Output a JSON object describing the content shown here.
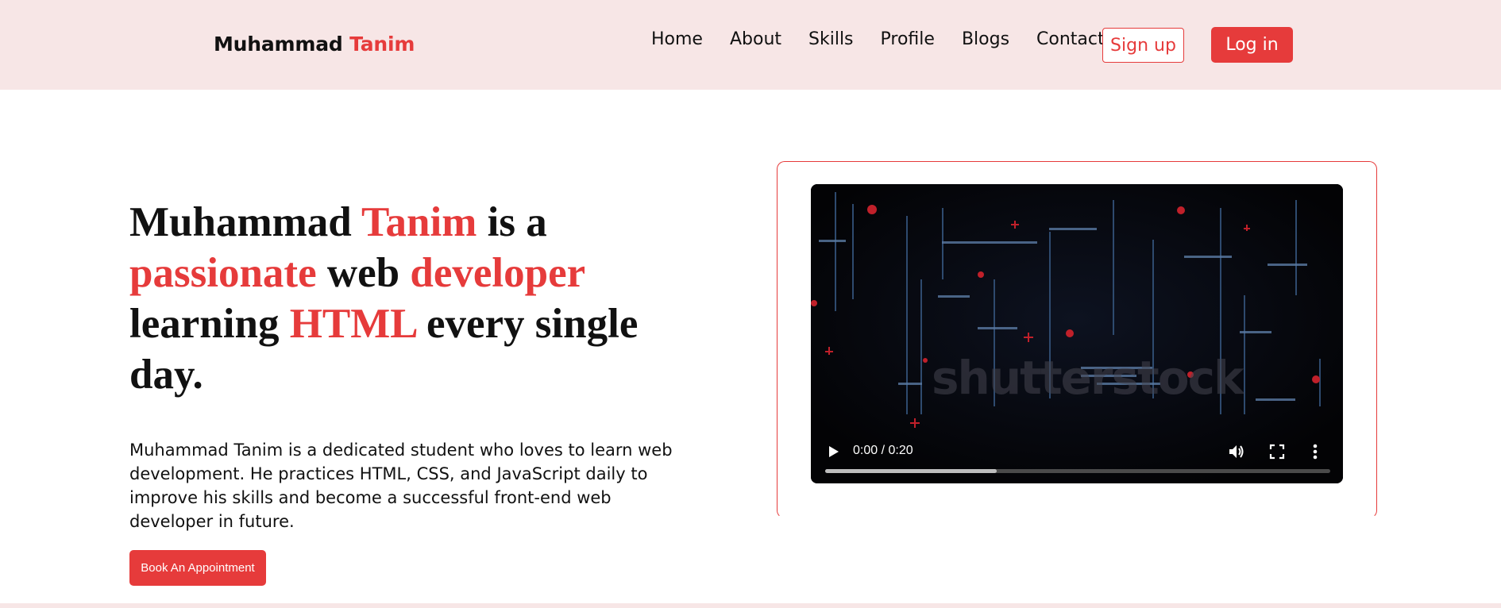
{
  "header": {
    "brand_first": "Muhammad",
    "brand_accent": "Tanim",
    "nav": [
      "Home",
      "About",
      "Skills",
      "Profile",
      "Blogs",
      "Contact"
    ],
    "signup_label": "Sign up",
    "login_label": "Log in"
  },
  "hero": {
    "title_parts": {
      "p1": "Muhammad ",
      "p2": "Tanim",
      "p3": " is a ",
      "p4": "passionate",
      "p5": " web ",
      "p6": "developer",
      "p7": " learning ",
      "p8": "HTML",
      "p9": " every single day."
    },
    "description": "Muhammad Tanim is a dedicated student who loves to learn web development. He practices HTML, CSS, and JavaScript daily to improve his skills and become a successful front-end web developer in future.",
    "cta_label": "Book An Appointment"
  },
  "video": {
    "watermark": "shutterstock",
    "time": "0:00 / 0:20",
    "progress_fraction": 0.34
  },
  "colors": {
    "accent": "#e63b3b",
    "header_bg": "#f7e6e6"
  },
  "icons": {
    "play": "play-icon",
    "volume": "volume-icon",
    "fullscreen": "fullscreen-icon",
    "more": "more-vert-icon"
  }
}
